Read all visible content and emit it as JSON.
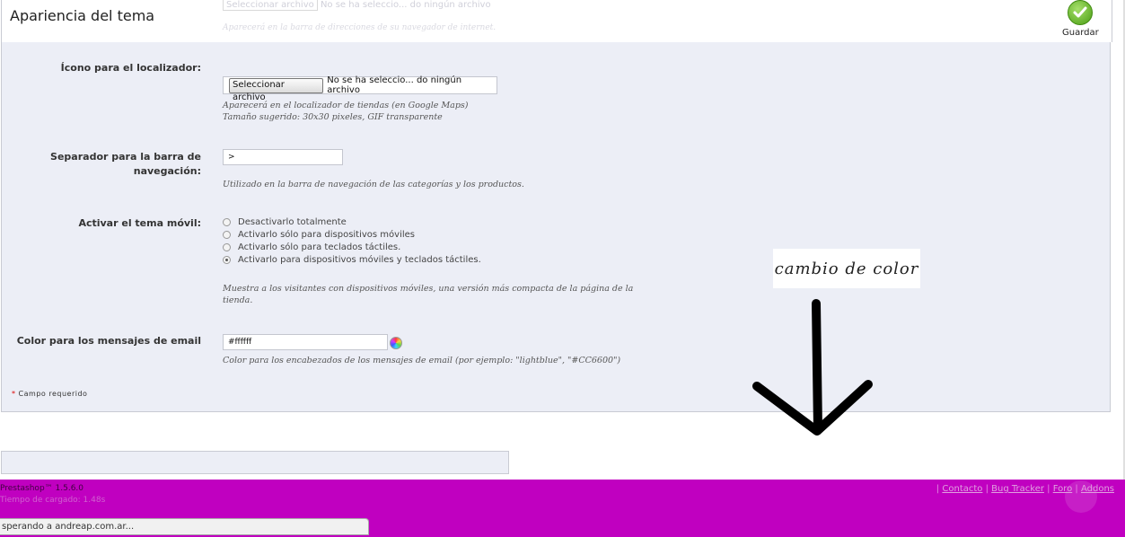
{
  "header": {
    "title": "Apariencia del tema",
    "faded_file_button": "Seleccionar archivo",
    "faded_file_status": "No se ha seleccio... do ningún archivo",
    "faded_help": "Aparecerá en la barra de direcciones de su navegador de internet.",
    "save_label": "Guardar"
  },
  "form": {
    "locator_icon": {
      "label": "Ícono para el localizador:",
      "button": "Seleccionar archivo",
      "status": "No se ha seleccio... do ningún archivo",
      "help_line1": "Aparecerá en el localizador de tiendas (en Google Maps)",
      "help_line2": "Tamaño sugerido: 30x30 pixeles, GIF transparente"
    },
    "nav_separator": {
      "label_line1": "Separador para la barra de",
      "label_line2": "navegación:",
      "value": ">",
      "help": "Utilizado en la barra de navegación de las categorías y los productos."
    },
    "mobile_theme": {
      "label": "Activar el tema móvil:",
      "options": [
        {
          "label": "Desactivarlo totalmente",
          "checked": false
        },
        {
          "label": "Activarlo sólo para dispositivos móviles",
          "checked": false
        },
        {
          "label": "Activarlo sólo para teclados táctiles.",
          "checked": false
        },
        {
          "label": "Activarlo para dispositivos móviles y teclados táctiles.",
          "checked": true
        }
      ],
      "help_line1": "Muestra a los visitantes con dispositivos móviles, una versión más compacta de la página de la",
      "help_line2": "tienda."
    },
    "email_color": {
      "label": "Color para los mensajes de email",
      "value": "#ffffff",
      "help": "Color para los encabezados de los mensajes de email (por ejemplo: \"lightblue\", \"#CC6600\")"
    },
    "required_note": "Campo requerido",
    "required_star": "*"
  },
  "annotation": {
    "note": "cambio de color"
  },
  "footer": {
    "version": "Prestashop™ 1.5.6.0",
    "load_time": "Tiempo de cargado: 1.48s",
    "links": [
      "Contacto",
      "Bug Tracker",
      "Foro",
      "Addons"
    ]
  },
  "statusbar": {
    "text": "sperando a andreap.com.ar..."
  },
  "colors": {
    "panel_bg": "#eceef6",
    "footer_bg": "#c000c0",
    "save_green": "#4a9d13"
  }
}
